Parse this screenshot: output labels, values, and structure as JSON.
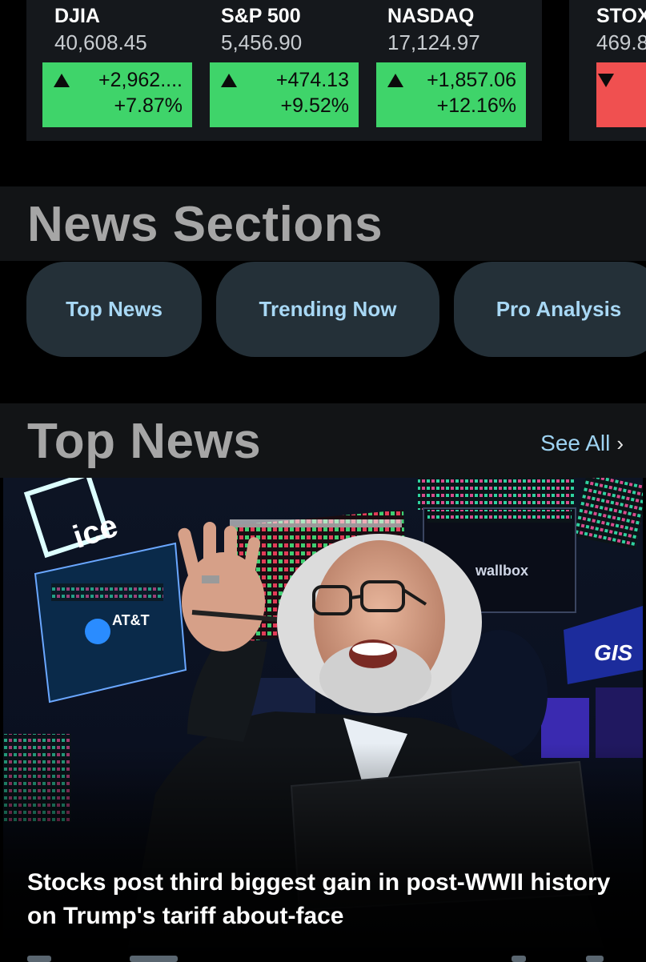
{
  "tickers": [
    {
      "symbol": "DJIA",
      "price": "40,608.45",
      "change": "+2,962....",
      "percent": "+7.87%",
      "direction": "up"
    },
    {
      "symbol": "S&P 500",
      "price": "5,456.90",
      "change": "+474.13",
      "percent": "+9.52%",
      "direction": "up"
    },
    {
      "symbol": "NASDAQ",
      "price": "17,124.97",
      "change": "+1,857.06",
      "percent": "+12.16%",
      "direction": "up"
    },
    {
      "symbol": "STOX",
      "price": "469.8",
      "change": "",
      "percent": "",
      "direction": "down"
    }
  ],
  "news_sections": {
    "title": "News Sections",
    "pills": [
      "Top News",
      "Trending Now",
      "Pro Analysis"
    ]
  },
  "top_news": {
    "title": "Top News",
    "see_all": "See All",
    "headline": "Stocks post third biggest gain in post-WWII history on Trump's tariff about-face",
    "photo_signs": {
      "exchange_logo": "ice",
      "att": "AT&T",
      "wallbox": "wallbox",
      "gis": "GIS"
    }
  },
  "colors": {
    "up": "#3fd46a",
    "down": "#f05050",
    "accent": "#9ed3f2",
    "pill_bg": "#243038"
  }
}
